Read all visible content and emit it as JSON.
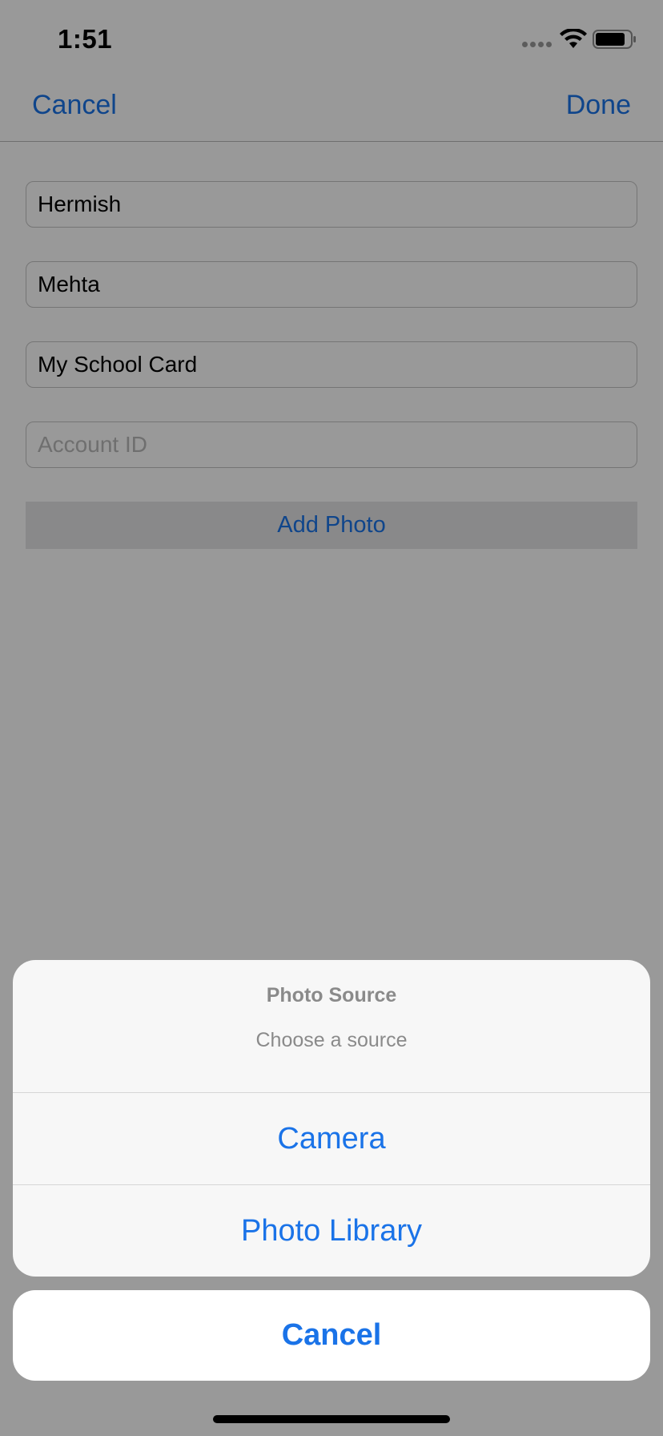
{
  "status_bar": {
    "time": "1:51",
    "icons": [
      "signal-dots-icon",
      "wifi-icon",
      "battery-icon"
    ]
  },
  "nav": {
    "cancel_label": "Cancel",
    "done_label": "Done"
  },
  "form": {
    "first_name_value": "Hermish",
    "last_name_value": "Mehta",
    "card_name_value": "My School Card",
    "account_id_placeholder": "Account ID",
    "add_photo_label": "Add Photo"
  },
  "action_sheet": {
    "title": "Photo Source",
    "message": "Choose a source",
    "actions": [
      {
        "label": "Camera"
      },
      {
        "label": "Photo Library"
      }
    ],
    "cancel_label": "Cancel"
  },
  "colors": {
    "accent": "#1a73e8",
    "overlay": "rgba(0,0,0,0.40)",
    "sheet_background": "#f7f7f7"
  }
}
